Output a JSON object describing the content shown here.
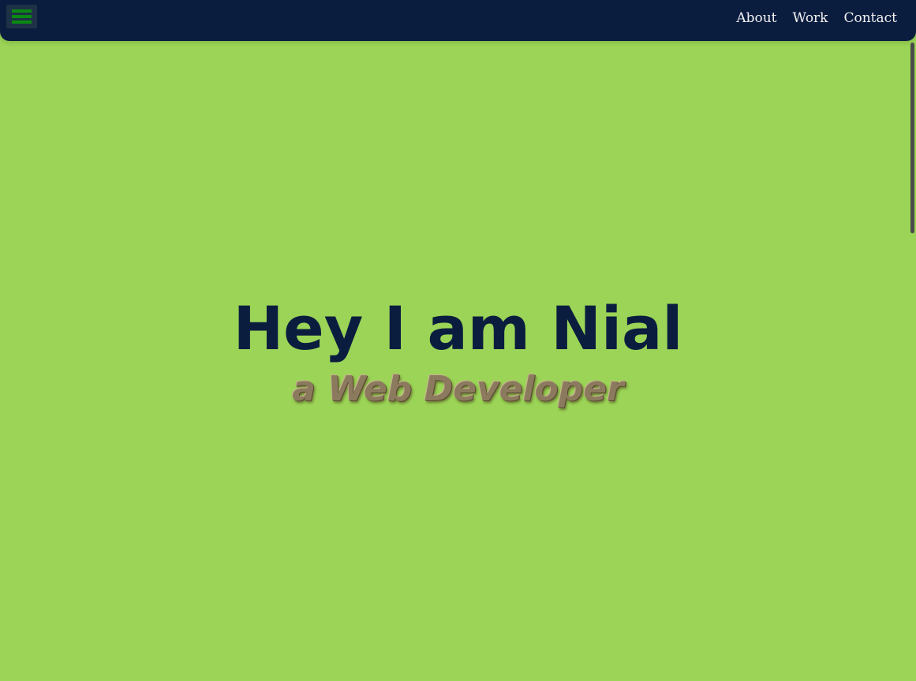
{
  "navbar": {
    "menu_icon": "hamburger-menu-icon",
    "links": [
      {
        "label": "About"
      },
      {
        "label": "Work"
      },
      {
        "label": "Contact"
      }
    ],
    "background_color": "#0b1d3f",
    "accent_color": "#0a8a12"
  },
  "hero": {
    "title": "Hey I am Nial",
    "subtitle": "a Web Developer",
    "background_color": "#9bd456",
    "title_color": "#0b1d3f"
  }
}
